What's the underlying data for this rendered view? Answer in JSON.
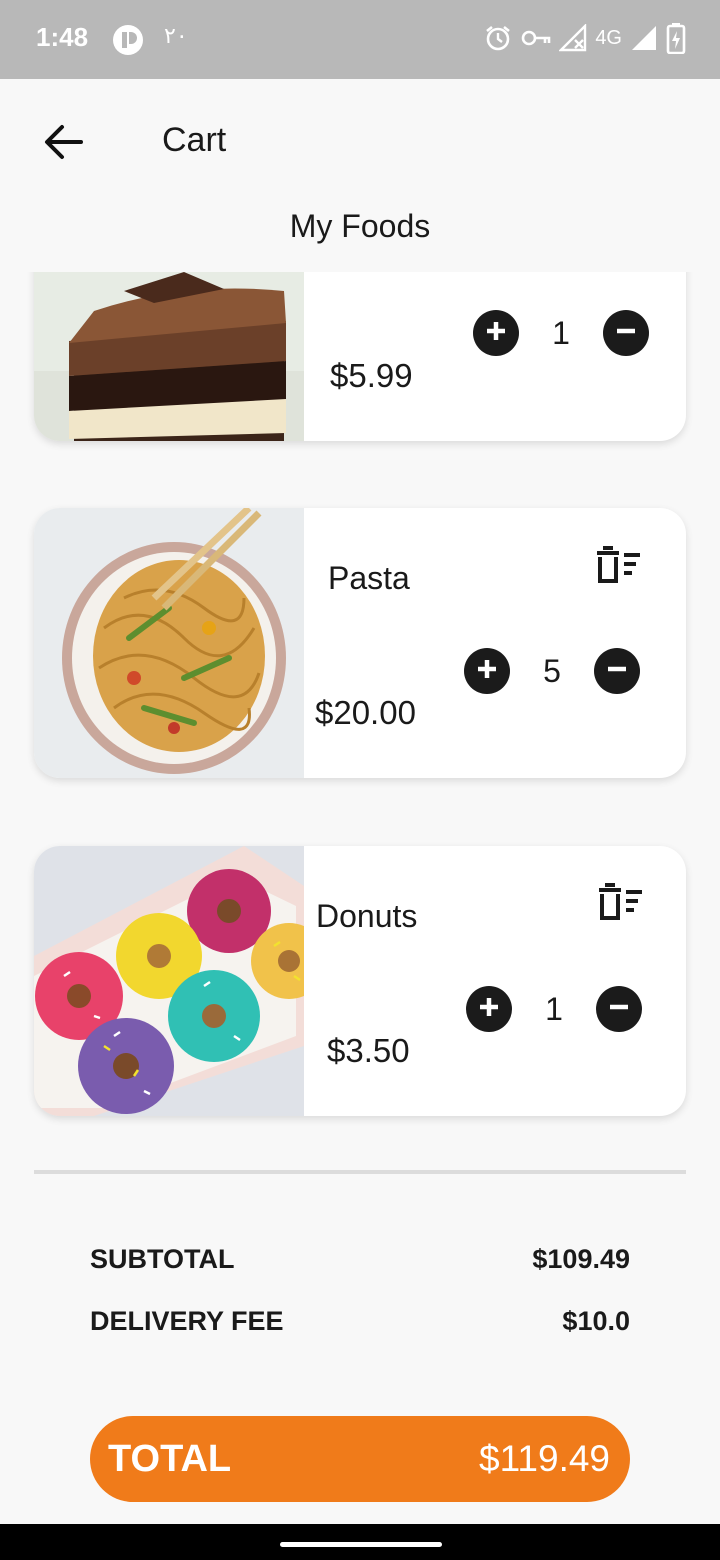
{
  "status_bar": {
    "time": "1:48",
    "notification_text": "٢٠",
    "network": "4G",
    "icons": [
      "app-icon",
      "alarm-icon",
      "vpn-key-icon",
      "signal-off-icon",
      "signal-icon",
      "battery-charging-icon"
    ]
  },
  "header": {
    "title": "Cart",
    "back_icon": "arrow-left-icon"
  },
  "section": {
    "title": "My Foods"
  },
  "cart_items": [
    {
      "name": "",
      "price": "$5.99",
      "quantity": "1",
      "image": "chocolate-cake-image"
    },
    {
      "name": "Pasta",
      "price": "$20.00",
      "quantity": "5",
      "image": "pasta-noodles-image"
    },
    {
      "name": "Donuts",
      "price": "$3.50",
      "quantity": "1",
      "image": "donuts-box-image"
    }
  ],
  "summary": {
    "subtotal_label": "SUBTOTAL",
    "subtotal_value": "$109.49",
    "delivery_label": "DELIVERY FEE",
    "delivery_value": "$10.0"
  },
  "total": {
    "label": "TOTAL",
    "value": "$119.49"
  },
  "colors": {
    "accent": "#f07b1a",
    "status_bar": "#b8b8b8",
    "background": "#f8f8f8",
    "button_dark": "#1b1b1b"
  }
}
